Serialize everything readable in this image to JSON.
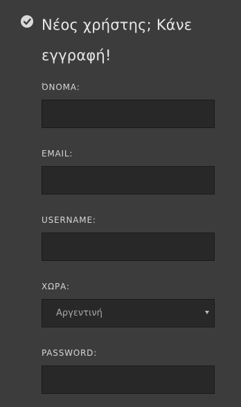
{
  "header": {
    "title": "Νέος χρήστης; Κάνε εγγραφή!",
    "icon": "check-circle-icon"
  },
  "form": {
    "name_label": "ΌΝΟΜΑ:",
    "email_label": "EMAIL:",
    "username_label": "USERNAME:",
    "country_label": "ΧΩΡΑ:",
    "country_value": "Αργεντινή",
    "password_label": "PASSWORD:"
  },
  "colors": {
    "background": "#3c3c3c",
    "input_background": "#282828",
    "text": "#e6e6e6"
  }
}
